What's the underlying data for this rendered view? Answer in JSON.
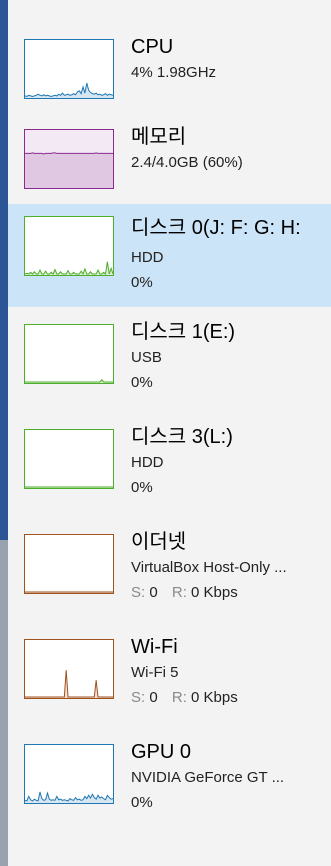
{
  "performance_list": {
    "items": [
      {
        "id": "cpu",
        "title": "CPU",
        "subtitle": "4% 1.98GHz",
        "detail": "",
        "color": "#1f77b4",
        "fill": "#ffffff",
        "selected": false,
        "graph": [
          2,
          1,
          3,
          2,
          1,
          2,
          3,
          5,
          3,
          2,
          4,
          2,
          3,
          2,
          1,
          2,
          3,
          2,
          5,
          3,
          7,
          3,
          4,
          5,
          3,
          4,
          6,
          4,
          9,
          11,
          6,
          18,
          7,
          25,
          12,
          8,
          6,
          5,
          7,
          4,
          5,
          3,
          4,
          6,
          3,
          5,
          4,
          3
        ]
      },
      {
        "id": "memory",
        "title": "메모리",
        "subtitle": "2.4/4.0GB (60%)",
        "detail": "",
        "color": "#8b2b8f",
        "fill": "#f3e9f4",
        "selected": false,
        "graph": [
          60,
          60,
          60,
          60,
          61,
          60,
          60,
          60,
          60,
          60,
          59,
          60,
          60,
          60,
          60,
          61,
          61,
          60,
          60,
          60,
          60,
          60,
          60,
          60,
          60,
          60,
          60,
          60,
          60,
          60,
          60,
          60,
          60,
          60,
          60,
          60,
          60,
          60,
          61,
          60,
          60,
          60,
          60,
          60,
          60,
          60,
          60,
          60
        ]
      },
      {
        "id": "disk0",
        "title": "디스크 0(J: F: G: H:",
        "subtitle": "HDD",
        "detail": "0%",
        "color": "#4cae2b",
        "fill": "#ffffff",
        "selected": true,
        "graph": [
          0,
          1,
          0,
          3,
          0,
          4,
          0,
          0,
          7,
          0,
          0,
          5,
          0,
          0,
          3,
          0,
          8,
          0,
          0,
          4,
          0,
          0,
          0,
          6,
          0,
          0,
          3,
          0,
          0,
          0,
          5,
          0,
          9,
          0,
          0,
          4,
          0,
          0,
          0,
          7,
          0,
          0,
          3,
          0,
          22,
          0,
          10,
          0
        ]
      },
      {
        "id": "disk1",
        "title": "디스크 1(E:)",
        "subtitle": "USB",
        "detail": "0%",
        "color": "#4cae2b",
        "fill": "#ffffff",
        "selected": false,
        "graph": [
          0,
          0,
          0,
          0,
          0,
          0,
          0,
          0,
          0,
          0,
          0,
          0,
          0,
          0,
          0,
          0,
          0,
          0,
          0,
          0,
          0,
          0,
          0,
          0,
          0,
          0,
          0,
          0,
          0,
          0,
          0,
          0,
          0,
          0,
          0,
          0,
          0,
          0,
          0,
          0,
          0,
          4,
          0,
          0,
          0,
          0,
          0,
          0
        ]
      },
      {
        "id": "disk3",
        "title": "디스크 3(L:)",
        "subtitle": "HDD",
        "detail": "0%",
        "color": "#4cae2b",
        "fill": "#ffffff",
        "selected": false,
        "graph": [
          0,
          0,
          0,
          0,
          0,
          0,
          0,
          0,
          0,
          0,
          0,
          0,
          0,
          0,
          0,
          0,
          0,
          0,
          0,
          0,
          0,
          0,
          0,
          0,
          0,
          0,
          0,
          0,
          0,
          0,
          0,
          0,
          0,
          0,
          0,
          0,
          0,
          0,
          0,
          0,
          0,
          0,
          0,
          0,
          0,
          0,
          0,
          0
        ]
      },
      {
        "id": "ethernet",
        "title": "이더넷",
        "subtitle": "VirtualBox Host-Only ...",
        "send_label": "S:",
        "send_value": "0",
        "recv_label": "R:",
        "recv_value": "0 Kbps",
        "color": "#a0521d",
        "fill": "#ffffff",
        "selected": false,
        "graph": [
          0,
          0,
          0,
          0,
          0,
          0,
          0,
          0,
          0,
          0,
          0,
          0,
          0,
          0,
          0,
          0,
          0,
          0,
          0,
          0,
          0,
          0,
          0,
          0,
          0,
          0,
          0,
          0,
          0,
          0,
          0,
          0,
          0,
          0,
          0,
          0,
          0,
          0,
          0,
          0,
          0,
          0,
          0,
          0,
          0,
          0,
          0,
          0
        ]
      },
      {
        "id": "wifi",
        "title": "Wi-Fi",
        "subtitle": "Wi-Fi 5",
        "send_label": "S:",
        "send_value": "0",
        "recv_label": "R:",
        "recv_value": "0 Kbps",
        "color": "#a0521d",
        "fill": "#ffffff",
        "selected": false,
        "graph": [
          0,
          0,
          0,
          0,
          0,
          0,
          0,
          0,
          0,
          0,
          0,
          0,
          0,
          0,
          0,
          0,
          0,
          0,
          0,
          0,
          0,
          0,
          48,
          0,
          0,
          0,
          0,
          0,
          0,
          0,
          0,
          0,
          0,
          0,
          0,
          0,
          0,
          0,
          30,
          0,
          0,
          0,
          0,
          0,
          0,
          0,
          0,
          0
        ]
      },
      {
        "id": "gpu0",
        "title": "GPU 0",
        "subtitle": "NVIDIA GeForce GT ...",
        "detail": "0%",
        "color": "#1f77b4",
        "fill": "#ffffff",
        "selected": false,
        "graph": [
          3,
          2,
          10,
          4,
          2,
          5,
          3,
          2,
          18,
          6,
          3,
          4,
          16,
          5,
          3,
          4,
          3,
          10,
          4,
          5,
          3,
          4,
          3,
          2,
          6,
          4,
          3,
          8,
          4,
          5,
          3,
          4,
          10,
          6,
          12,
          7,
          14,
          8,
          5,
          12,
          7,
          9,
          6,
          4,
          12,
          8,
          5,
          6
        ]
      }
    ]
  }
}
